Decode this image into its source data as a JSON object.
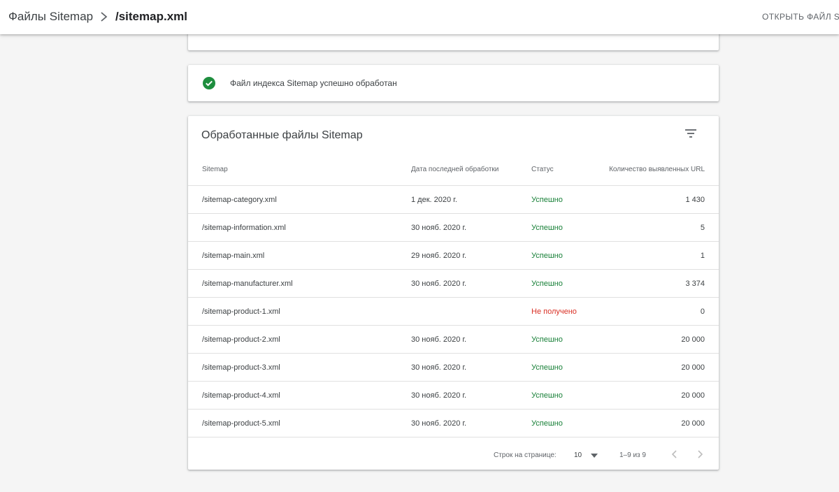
{
  "header": {
    "parent": "Файлы Sitemap",
    "current": "/sitemap.xml",
    "open_button": "ОТКРЫТЬ ФАЙЛ SIT"
  },
  "status_card": {
    "text": "Файл индекса Sitemap успешно обработан"
  },
  "table": {
    "title": "Обработанные файлы Sitemap",
    "columns": {
      "sitemap": "Sitemap",
      "date": "Дата последней обработки",
      "status": "Статус",
      "count": "Количество выявленных URL"
    },
    "rows": [
      {
        "sitemap": "/sitemap-category.xml",
        "date": "1 дек. 2020 г.",
        "status": "Успешно",
        "ok": true,
        "count": "1 430"
      },
      {
        "sitemap": "/sitemap-information.xml",
        "date": "30 нояб. 2020 г.",
        "status": "Успешно",
        "ok": true,
        "count": "5"
      },
      {
        "sitemap": "/sitemap-main.xml",
        "date": "29 нояб. 2020 г.",
        "status": "Успешно",
        "ok": true,
        "count": "1"
      },
      {
        "sitemap": "/sitemap-manufacturer.xml",
        "date": "30 нояб. 2020 г.",
        "status": "Успешно",
        "ok": true,
        "count": "3 374"
      },
      {
        "sitemap": "/sitemap-product-1.xml",
        "date": "",
        "status": "Не получено",
        "ok": false,
        "count": "0"
      },
      {
        "sitemap": "/sitemap-product-2.xml",
        "date": "30 нояб. 2020 г.",
        "status": "Успешно",
        "ok": true,
        "count": "20 000"
      },
      {
        "sitemap": "/sitemap-product-3.xml",
        "date": "30 нояб. 2020 г.",
        "status": "Успешно",
        "ok": true,
        "count": "20 000"
      },
      {
        "sitemap": "/sitemap-product-4.xml",
        "date": "30 нояб. 2020 г.",
        "status": "Успешно",
        "ok": true,
        "count": "20 000"
      },
      {
        "sitemap": "/sitemap-product-5.xml",
        "date": "30 нояб. 2020 г.",
        "status": "Успешно",
        "ok": true,
        "count": "20 000"
      }
    ]
  },
  "pagination": {
    "rows_per_page_label": "Строк на странице:",
    "rows_per_page": "10",
    "range": "1–9 из 9"
  },
  "colors": {
    "success": "#188038",
    "error": "#d93025",
    "check": "#1e8e3e"
  },
  "icons": {
    "breadcrumb_separator": "chevron-right-icon",
    "status": "check-circle-icon",
    "filter": "filter-list-icon",
    "dropdown": "arrow-drop-down-icon",
    "prev": "chevron-left-icon",
    "next": "chevron-right-icon"
  }
}
